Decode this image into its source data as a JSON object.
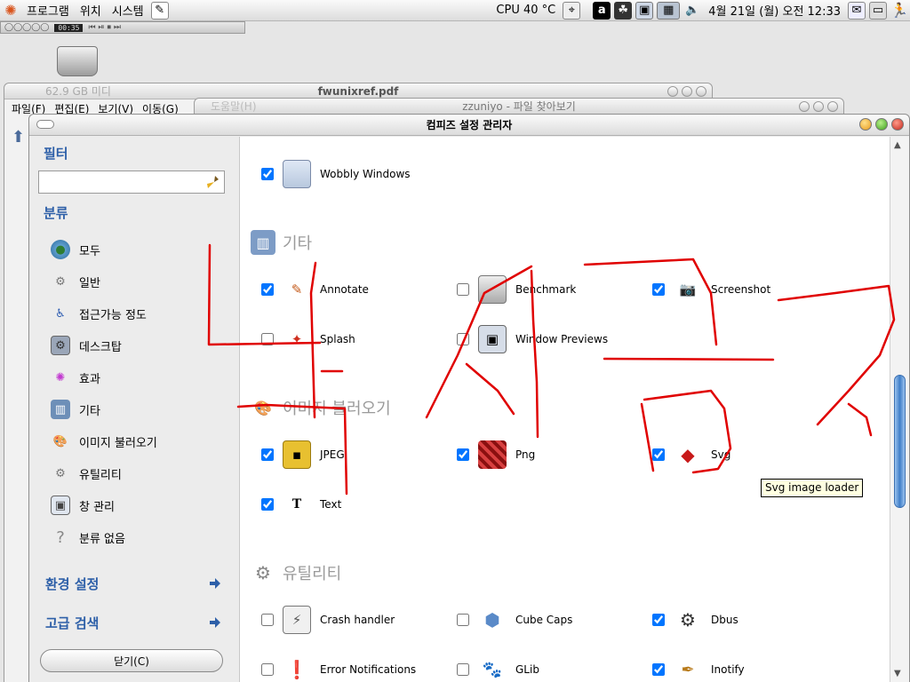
{
  "top_panel": {
    "menus": [
      "프로그램",
      "위치",
      "시스템"
    ],
    "cpu": "CPU 40 °C",
    "clock": "4월 21일 (월) 오전 12:33"
  },
  "mini_player": {
    "time": "00:35"
  },
  "background_windows": {
    "drive": {
      "title": "62.9 GB 미디",
      "menus": [
        "파일(F)",
        "편집(E)",
        "보기(V)",
        "이동(G)"
      ]
    },
    "pdf": {
      "title": "fwunixref.pdf",
      "menu": "도움말(H)"
    },
    "browser": {
      "title": "zzuniyo - 파일 찾아보기"
    }
  },
  "window": {
    "title": "컴피즈 설정 관리자"
  },
  "sidebar": {
    "filter_label": "필터",
    "filter_value": "",
    "category_label": "분류",
    "categories": [
      {
        "label": "모두",
        "icon": "globe-icon"
      },
      {
        "label": "일반",
        "icon": "gear-icon"
      },
      {
        "label": "접근가능 정도",
        "icon": "wheelchair-icon"
      },
      {
        "label": "데스크탑",
        "icon": "desktop-icon"
      },
      {
        "label": "효과",
        "icon": "sparkle-icon"
      },
      {
        "label": "기타",
        "icon": "books-icon"
      },
      {
        "label": "이미지 불러오기",
        "icon": "palette-icon"
      },
      {
        "label": "유틸리티",
        "icon": "gear-icon"
      },
      {
        "label": "창 관리",
        "icon": "window-icon"
      },
      {
        "label": "분류 없음",
        "icon": "question-icon"
      }
    ],
    "preferences_label": "환경 설정",
    "advanced_search_label": "고급 검색",
    "close_button": "닫기(C)"
  },
  "content": {
    "top_plugin": {
      "label": "Wobbly Windows",
      "checked": true
    },
    "sections": [
      {
        "title": "기타",
        "plugins": [
          {
            "label": "Annotate",
            "checked": true
          },
          {
            "label": "Benchmark",
            "checked": false
          },
          {
            "label": "Screenshot",
            "checked": true
          },
          {
            "label": "Splash",
            "checked": false
          },
          {
            "label": "Window Previews",
            "checked": false
          }
        ]
      },
      {
        "title": "이미지 불러오기",
        "plugins": [
          {
            "label": "JPEG",
            "checked": true
          },
          {
            "label": "Png",
            "checked": true
          },
          {
            "label": "Svg",
            "checked": true
          },
          {
            "label": "Text",
            "checked": true
          }
        ]
      },
      {
        "title": "유틸리티",
        "plugins": [
          {
            "label": "Crash handler",
            "checked": false
          },
          {
            "label": "Cube Caps",
            "checked": false
          },
          {
            "label": "Dbus",
            "checked": true
          },
          {
            "label": "Error Notifications",
            "checked": false
          },
          {
            "label": "GLib",
            "checked": false
          },
          {
            "label": "Inotify",
            "checked": true
          }
        ]
      }
    ]
  },
  "tooltip": "Svg image loader",
  "colors": {
    "accent": "#2d5fa8",
    "scribble": "#e00000"
  }
}
